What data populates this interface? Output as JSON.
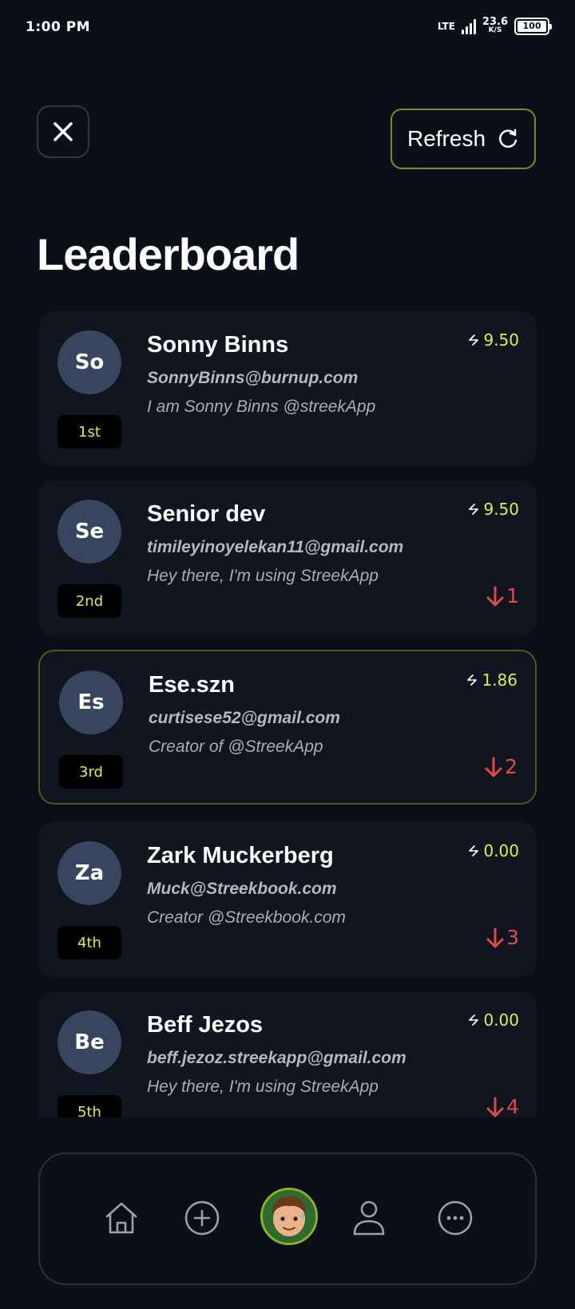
{
  "status_bar": {
    "time": "1:00 PM",
    "network": "LTE",
    "speed_value": "23.6",
    "speed_unit": "K/S",
    "battery": "100"
  },
  "header": {
    "close_icon": "close-icon",
    "refresh_label": "Refresh",
    "refresh_icon": "refresh-icon"
  },
  "title": "Leaderboard",
  "leaderboard": [
    {
      "initials": "So",
      "name": "Sonny Binns",
      "email": "SonnyBinns@burnup.com",
      "bio": "I am Sonny Binns @streekApp",
      "rank": "1st",
      "score": "9.50",
      "change": ""
    },
    {
      "initials": "Se",
      "name": "Senior dev",
      "email": "timileyinoyelekan11@gmail.com",
      "bio": "Hey there, I'm using StreekApp",
      "rank": "2nd",
      "score": "9.50",
      "change": "1"
    },
    {
      "initials": "Es",
      "name": "Ese.szn",
      "email": "curtisese52@gmail.com",
      "bio": "Creator of @StreekApp",
      "rank": "3rd",
      "score": "1.86",
      "change": "2"
    },
    {
      "initials": "Za",
      "name": "Zark Muckerberg",
      "email": "Muck@Streekbook.com",
      "bio": "Creator @Streekbook.com",
      "rank": "4th",
      "score": "0.00",
      "change": "3"
    },
    {
      "initials": "Be",
      "name": "Beff Jezos",
      "email": "beff.jezoz.streekapp@gmail.com",
      "bio": "Hey there, I'm using StreekApp",
      "rank": "5th",
      "score": "0.00",
      "change": "4"
    }
  ],
  "colors": {
    "accent": "#d9f04a",
    "down": "#e2484a",
    "card": "#101520",
    "avatar": "#37465e"
  },
  "bottom_nav": {
    "items": [
      "home-icon",
      "add-circle-icon",
      "profile-avatar",
      "person-icon",
      "more-icon"
    ]
  }
}
